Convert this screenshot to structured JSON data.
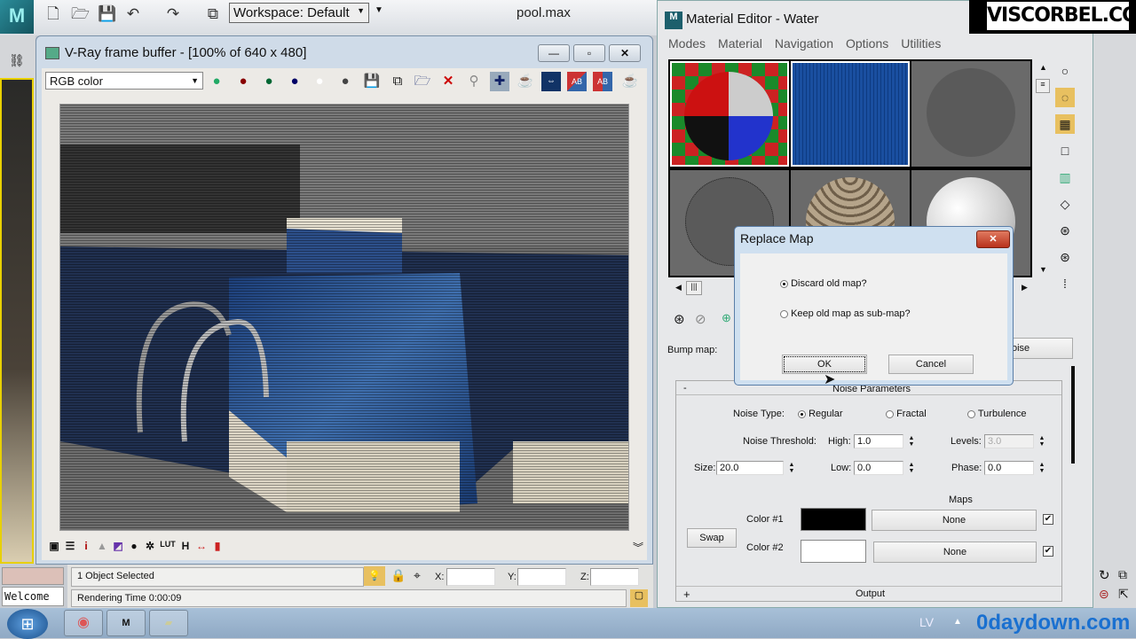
{
  "app": {
    "logo": "M",
    "workspace": "Workspace: Default",
    "filename": "pool.max",
    "icons": [
      "new-icon",
      "open-icon",
      "save-icon",
      "undo-icon",
      "redo-icon",
      "project-icon"
    ]
  },
  "vfb": {
    "title": "V-Ray frame buffer - [100% of 640 x 480]",
    "channel": "RGB color",
    "toolbar_icons": [
      "rgb-icon",
      "red-channel-icon",
      "green-channel-icon",
      "blue-channel-icon",
      "alpha-icon",
      "mono-icon",
      "save-icon",
      "save-all-icon",
      "load-icon",
      "clear-icon",
      "track-mouse-icon",
      "region-icon",
      "render-teapot-icon",
      "compare-icon",
      "ab-h-icon",
      "ab-v-icon",
      "render-icon"
    ],
    "bottom_icons": [
      "window-icon",
      "stamp-icon",
      "info-icon",
      "histogram-icon",
      "color-correction-icon",
      "lens-icon",
      "exposure-icon",
      "lut-icon",
      "h-icon",
      "levels-icon",
      "srgb-icon"
    ],
    "bottom_labels": {
      "info": "i",
      "lut": "LUT",
      "h": "H"
    }
  },
  "status": {
    "selection": "1 Object Selected",
    "render_time": "Rendering Time  0:00:09",
    "x_label": "X:",
    "y_label": "Y:",
    "z_label": "Z:",
    "welcome": "Welcome"
  },
  "material_editor": {
    "title": "Material Editor - Water",
    "menu": [
      "Modes",
      "Material",
      "Navigation",
      "Options",
      "Utilities"
    ],
    "bump_label": "Bump map:",
    "bump_map_button": "oise",
    "noise_parameters": "Noise Parameters",
    "noise_type_label": "Noise Type:",
    "noise_types": [
      "Regular",
      "Fractal",
      "Turbulence"
    ],
    "noise_type_selected": "Regular",
    "threshold_label": "Noise Threshold:",
    "high_label": "High:",
    "high": "1.0",
    "levels_label": "Levels:",
    "levels": "3.0",
    "size_label": "Size:",
    "size": "20.0",
    "low_label": "Low:",
    "low": "0.0",
    "phase_label": "Phase:",
    "phase": "0.0",
    "maps_label": "Maps",
    "swap": "Swap",
    "color1_label": "Color #1",
    "color1": "#000000",
    "color1_map": "None",
    "color1_enabled": true,
    "color2_label": "Color #2",
    "color2": "#ffffff",
    "color2_map": "None",
    "color2_enabled": true,
    "output_label": "Output",
    "collapse": "-",
    "expand": "+"
  },
  "dialog": {
    "title": "Replace Map",
    "option1": "Discard old map?",
    "option2": "Keep old map as sub-map?",
    "selected": "Discard old map?",
    "ok": "OK",
    "cancel": "Cancel"
  },
  "watermark": "VISCORBEL.COM",
  "taskbar": {
    "lang": "LV",
    "watermark2": "0daydown.com"
  }
}
